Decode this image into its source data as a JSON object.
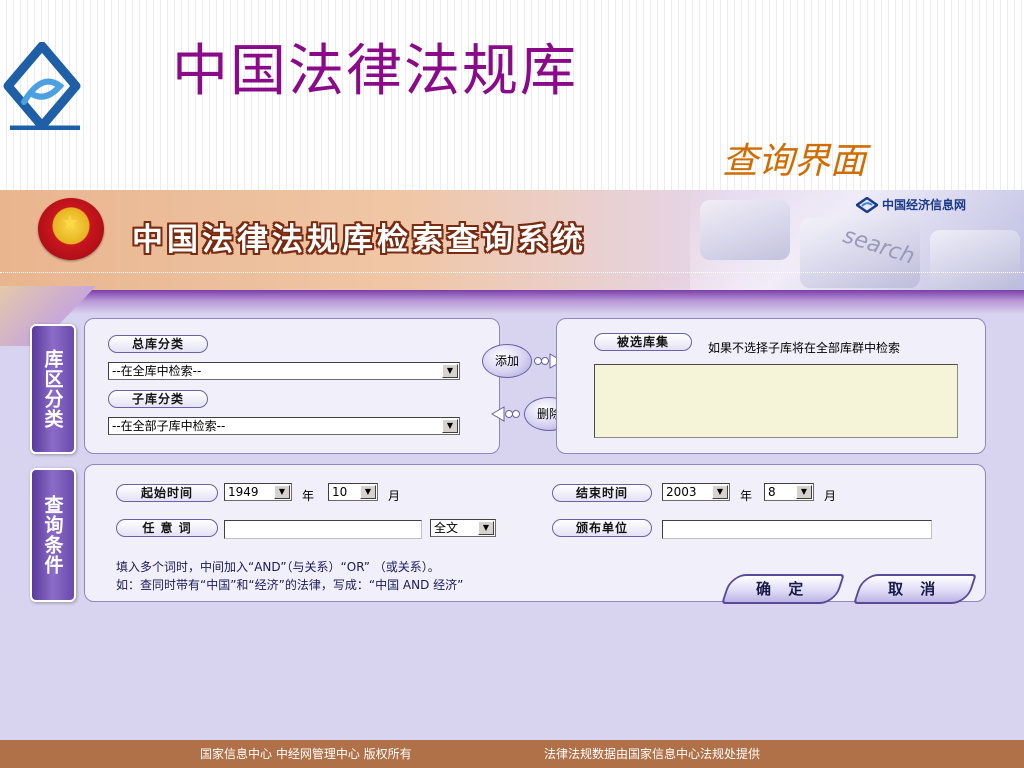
{
  "slide": {
    "title": "中国法律法规库",
    "subtitle": "查询界面"
  },
  "banner": {
    "system_title": "中国法律法规库检索查询系统",
    "partner_logo_text": "中国经济信息网",
    "keyboard_text": "search"
  },
  "side_tabs": {
    "library": "库区分类",
    "query": "查询条件"
  },
  "library_panel": {
    "main_label": "总库分类",
    "main_select_value": "--在全库中检索--",
    "sub_label": "子库分类",
    "sub_select_value": "--在全部子库中检索--",
    "add_button": "添加",
    "remove_button": "删除",
    "selected_label": "被选库集",
    "selected_hint": "如果不选择子库将在全部库群中检索",
    "selected_items": []
  },
  "query_panel": {
    "start_label": "起始时间",
    "start_year": "1949",
    "start_month": "10",
    "year_unit": "年",
    "month_unit": "月",
    "end_label": "结束时间",
    "end_year": "2003",
    "end_month": "8",
    "keyword_label": "任 意 词",
    "keyword_value": "",
    "scope_select": "全文",
    "issuer_label": "颁布单位",
    "issuer_value": "",
    "hint_line1": "填入多个词时，中间加入“AND”（与关系）“OR” （或关系）。",
    "hint_line2": "如：查同时带有“中国”和“经济”的法律，写成：“中国 AND 经济”",
    "confirm_button": "确 定",
    "cancel_button": "取 消"
  },
  "footer": {
    "text_left": "国家信息中心   中经网管理中心   版权所有",
    "text_right": "法律法规数据由国家信息中心法规处提供"
  },
  "colors": {
    "slide_title": "#8a0a8a",
    "slide_subtitle": "#d06c00",
    "app_background": "#d8d3ee",
    "footer": "#b07048"
  },
  "icons": {
    "slide_logo": "blue-swirl-logo-icon",
    "emblem": "national-emblem-icon",
    "partner": "cei-logo-icon"
  }
}
